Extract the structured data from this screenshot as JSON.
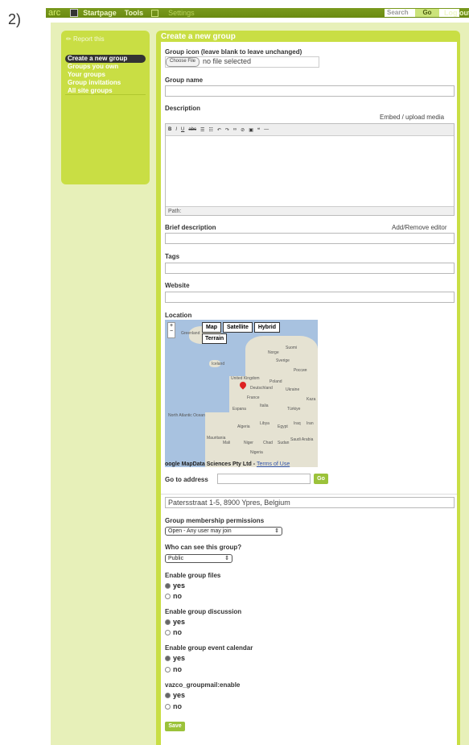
{
  "figure_label": "2)",
  "topbar": {
    "logo": "arc",
    "menu_items": [
      "Startpage",
      "Tools"
    ],
    "settings": "Settings",
    "search_placeholder": "Search",
    "go": "Go",
    "logout": "Log out"
  },
  "sidebar": {
    "report": "Report this",
    "items": [
      "Create a new group",
      "Groups you own",
      "Your groups",
      "Group invitations",
      "All site groups"
    ]
  },
  "form": {
    "title": "Create a new group",
    "icon_label": "Group icon (leave blank to leave unchanged)",
    "choose_file": "Choose File",
    "no_file": "no file selected",
    "name_label": "Group name",
    "description_label": "Description",
    "embed_media": "Embed / upload media",
    "path": "Path:",
    "brief_label": "Brief description",
    "add_remove_editor": "Add/Remove editor",
    "tags_label": "Tags",
    "website_label": "Website",
    "location_label": "Location",
    "map_buttons": [
      "Map",
      "Satellite",
      "Hybrid"
    ],
    "map_terrain": "Terrain",
    "map_attribution": "oogle MapData Sciences Pty Ltd -",
    "map_terms": "Terms of Use",
    "goto_label": "Go to address",
    "goto_go": "Go",
    "address_value": "Patersstraat 1-5, 8900 Ypres, Belgium",
    "membership_label": "Group membership permissions",
    "membership_value": "Open - Any user may join",
    "visibility_label": "Who can see this group?",
    "visibility_value": "Public",
    "files_label": "Enable group files",
    "discussion_label": "Enable group discussion",
    "calendar_label": "Enable group event calendar",
    "groupmail_label": "vazco_groupmail:enable",
    "yes": "yes",
    "no": "no",
    "save": "Save"
  },
  "map_places": [
    "Greenland",
    "Iceland",
    "Norge",
    "Sverige",
    "Suomi",
    "United Kingdom",
    "Deutschland",
    "France",
    "Espana",
    "Italia",
    "Türkiye",
    "Iraq",
    "Iran",
    "Algeria",
    "Libya",
    "Egypt",
    "Saudi Arabia",
    "Mali",
    "Niger",
    "Chad",
    "Sudan",
    "Nigeria",
    "North Atlantic Ocean",
    "Mauritania",
    "Россия",
    "Poland",
    "Ukraine",
    "Kaza"
  ],
  "colors": {
    "brand_green": "#c9de44",
    "topbar": "#7a9a1e",
    "button_green": "#9bc23a"
  }
}
